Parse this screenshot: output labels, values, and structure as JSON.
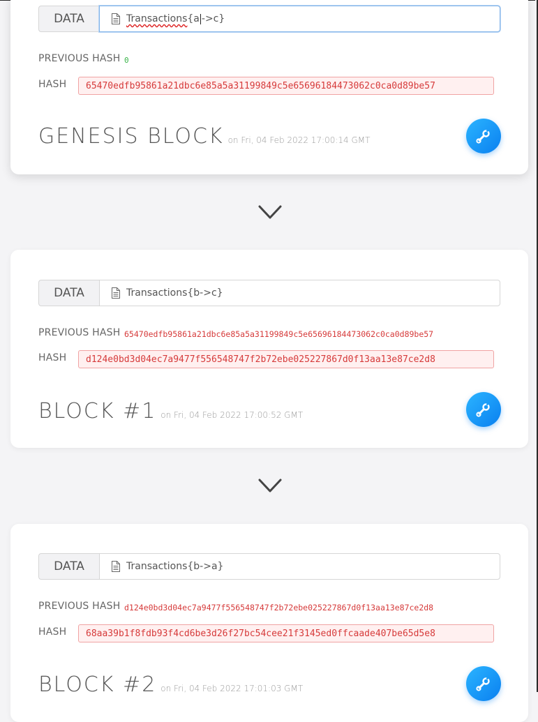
{
  "blocks": [
    {
      "data_label": "DATA",
      "data_value_pre": "Transactions",
      "data_value_a": "{a",
      "data_value_b": "->c}",
      "prev_label": "PREVIOUS HASH",
      "prev_hash": "0",
      "hash_label": "HASH",
      "hash": "65470edfb95861a21dbc6e85a5a31199849c5e65696184473062c0ca0d89be57",
      "title": "GENESIS BLOCK",
      "timestamp": "on Fri, 04 Feb 2022 17:00:14 GMT"
    },
    {
      "data_label": "DATA",
      "data_value": "Transactions{b->c}",
      "prev_label": "PREVIOUS HASH",
      "prev_hash": "65470edfb95861a21dbc6e85a5a31199849c5e65696184473062c0ca0d89be57",
      "hash_label": "HASH",
      "hash": "d124e0bd3d04ec7a9477f556548747f2b72ebe025227867d0f13aa13e87ce2d8",
      "title": "BLOCK #1",
      "timestamp": "on Fri, 04 Feb 2022 17:00:52 GMT"
    },
    {
      "data_label": "DATA",
      "data_value": "Transactions{b->a}",
      "prev_label": "PREVIOUS HASH",
      "prev_hash": "d124e0bd3d04ec7a9477f556548747f2b72ebe025227867d0f13aa13e87ce2d8",
      "hash_label": "HASH",
      "hash": "68aa39b1f8fdb93f4cd6be3d26f27bc54cee21f3145ed0ffcaade407be65d5e8",
      "title": "BLOCK #2",
      "timestamp": "on Fri, 04 Feb 2022 17:01:03 GMT"
    }
  ],
  "icons": {
    "data": "document-icon",
    "mine": "wrench-icon",
    "link": "chevron-down-icon"
  },
  "colors": {
    "accent": "#0a80f0",
    "hash_invalid": "#d63a3a",
    "prev_zero": "#3ab54a"
  }
}
